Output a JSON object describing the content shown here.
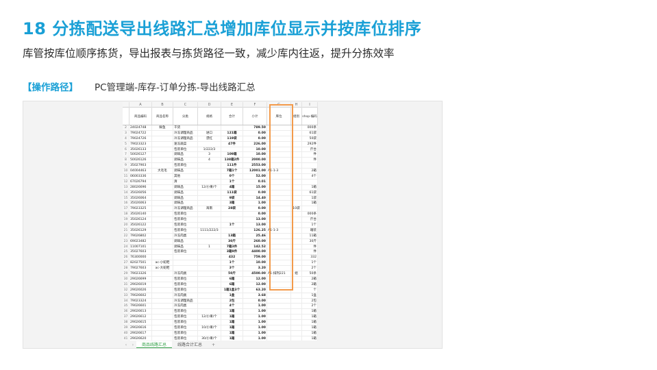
{
  "slide": {
    "title": "18  分拣配送导出线路汇总增加库位显示并按库位排序",
    "subtitle": "库管按库位顺序拣货，导出报表与拣货路径一致，减少库内往返，提升分拣效率",
    "path_tag": "【操作路径】",
    "path_text": "PC管理端-库存-订单分拣-导出线路汇总"
  },
  "sheet": {
    "column_letters": [
      "",
      "A",
      "B",
      "C",
      "D",
      "E",
      "F",
      "G",
      "H",
      "I"
    ],
    "header": [
      "",
      "商品编码",
      "商品名称",
      "分类",
      "规格",
      "合计",
      "小计",
      "库位",
      "组别",
      "shop-编码"
    ],
    "rows": [
      [
        "2",
        "24024748",
        "鲜鱼",
        "干货",
        "",
        "",
        "789.50",
        "",
        "",
        "000条"
      ],
      [
        "3",
        "79024722",
        "",
        "冷冻调理商品",
        "进口",
        "121箱",
        "0.00",
        "",
        "",
        "61袋"
      ],
      [
        "4",
        "79024726",
        "",
        "冷冻调理商品",
        "漂红",
        "119袋",
        "0.00",
        "",
        "",
        "50袋"
      ],
      [
        "5",
        "79023323",
        "",
        "速冻蔬菜",
        "",
        "47件",
        "226.00",
        "",
        "",
        "292件"
      ],
      [
        "6",
        "35026133",
        "",
        "包装单位",
        "1/222/3",
        "",
        "10.00",
        "",
        "",
        "斤台"
      ],
      [
        "7",
        "50026127",
        "",
        "调味品",
        "3",
        "109箱",
        "10.00",
        "",
        "",
        "件"
      ],
      [
        "8",
        "50026126",
        "",
        "调味品",
        "4",
        "138箱2件",
        "2000.00",
        "",
        "",
        "件"
      ],
      [
        "9",
        "35027903",
        "",
        "包装单位",
        "",
        "111件",
        "2553.00",
        "",
        "",
        ""
      ],
      [
        "10",
        "04004463",
        "大毛毛",
        "调味品",
        "",
        "7箱1个",
        "12001.00",
        "A1-1-3",
        "",
        "2箱"
      ],
      [
        "11",
        "06003336",
        "",
        "其他",
        "",
        "0个",
        "52.00",
        "",
        "",
        "4个"
      ],
      [
        "12",
        "67026794",
        "",
        "清",
        "",
        "1个",
        "0.01",
        "",
        "",
        ""
      ],
      [
        "13",
        "28026696",
        "",
        "调味品",
        "12/小果/个",
        "4箱",
        "15.00",
        "",
        "",
        "1箱"
      ],
      [
        "14",
        "35026056",
        "",
        "调味品",
        "",
        "111袋",
        "0.00",
        "",
        "",
        "61袋"
      ],
      [
        "15",
        "35026064",
        "",
        "调味品",
        "",
        "9袋",
        "14.40",
        "",
        "",
        "1袋"
      ],
      [
        "16",
        "35026063",
        "",
        "调味品",
        "",
        "3箱",
        "1.00",
        "",
        "",
        "1箱"
      ],
      [
        "17",
        "79023325",
        "",
        "冷冻调理商品",
        "海南",
        "28袋",
        "0.00",
        "",
        "10袋",
        ""
      ],
      [
        "18",
        "35026140",
        "",
        "包装单位",
        "",
        "",
        "0.00",
        "",
        "",
        "000条"
      ],
      [
        "19",
        "35026124",
        "",
        "包装单位",
        "",
        "",
        "13.00",
        "",
        "",
        "斤台"
      ],
      [
        "20",
        "35026122",
        "",
        "包装单位",
        "",
        "1个",
        "13.00",
        "",
        "",
        "1个"
      ],
      [
        "21",
        "35026129",
        "",
        "包装单位",
        "1111/222/3",
        "",
        "126.25",
        "A1-1-3",
        "",
        "箱装"
      ],
      [
        "22",
        "79026802",
        "",
        "冷冻肉类",
        "",
        "13箱",
        "25.46",
        "",
        "",
        "11箱"
      ],
      [
        "23",
        "69023482",
        "",
        "调味品",
        "",
        "30斤",
        "260.00",
        "",
        "",
        "30斤"
      ],
      [
        "24",
        "11007101",
        "",
        "调味品",
        "1",
        "7箱3件",
        "142.52",
        "",
        "",
        "件"
      ],
      [
        "25",
        "35027603",
        "",
        "包装单位",
        "",
        "3箱9件",
        "4400.00",
        "",
        "",
        "件"
      ],
      [
        "26",
        "76300000",
        "",
        "",
        "",
        "432",
        "759.00",
        "",
        "",
        "332"
      ],
      [
        "27",
        "82027501",
        "ac-小蛇鞋",
        "",
        "",
        "1个",
        "10.00",
        "",
        "",
        "1个"
      ],
      [
        "28",
        "79027603",
        "ac-大蛇鞋",
        "",
        "",
        "3个",
        "3.20",
        "",
        "",
        "2个"
      ],
      [
        "29",
        "79023326",
        "",
        "冷冻肉类",
        "",
        "50斤",
        "4500.00",
        "A1-排列221",
        "组",
        "50条"
      ],
      [
        "30",
        "29026699",
        "",
        "包装单位",
        "",
        "6箱",
        "12.00",
        "",
        "",
        "2箱"
      ],
      [
        "31",
        "29026019",
        "",
        "包装单位",
        "",
        "6箱",
        "12.00",
        "",
        "",
        "2箱"
      ],
      [
        "32",
        "29026026",
        "",
        "包装单位",
        "",
        "1箱1盒3个",
        "63.20",
        "",
        "",
        "个"
      ],
      [
        "33",
        "79026602",
        "",
        "冷冻肉类",
        "",
        "1盒",
        "3.68",
        "",
        "",
        "1盒"
      ],
      [
        "34",
        "79023324",
        "",
        "冷冻调理商品",
        "",
        "2包",
        "0.00",
        "",
        "",
        "2包"
      ],
      [
        "35",
        "79026601",
        "",
        "冷冻肉类",
        "",
        "4个",
        "1.00",
        "",
        "",
        "2个"
      ],
      [
        "36",
        "29026613",
        "",
        "包装单位",
        "",
        "1箱",
        "1.00",
        "",
        "",
        "1箱"
      ],
      [
        "37",
        "29026612",
        "",
        "包装单位",
        "12/小果/个",
        "1箱",
        "1.00",
        "",
        "",
        "1箱"
      ],
      [
        "38",
        "29026615",
        "",
        "包装单位",
        "",
        "1箱",
        "1.00",
        "",
        "",
        "1箱"
      ],
      [
        "39",
        "29026616",
        "",
        "包装单位",
        "10/小果/个",
        "1箱",
        "1.00",
        "",
        "",
        "1箱"
      ],
      [
        "40",
        "29026617",
        "",
        "包装单位",
        "",
        "1箱",
        "1.00",
        "",
        "",
        "1箱"
      ],
      [
        "41",
        "29026620",
        "",
        "包装单位",
        "30/小果/个",
        "1箱",
        "1.00",
        "",
        "",
        "1箱"
      ],
      [
        "42",
        "29026621",
        "",
        "包装单位",
        "",
        "1箱",
        "1.00",
        "",
        "",
        "1箱"
      ]
    ],
    "tabs": [
      "商品线路汇总",
      "线路合计汇总"
    ],
    "tab_nav_prev": "‹",
    "tab_nav_next": "›",
    "tab_add": "+"
  },
  "colors": {
    "accent": "#1aa0d6",
    "highlight": "#f39a4a"
  }
}
